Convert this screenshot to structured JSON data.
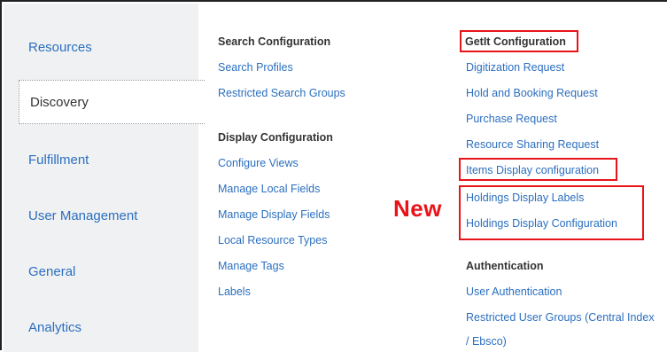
{
  "sidebar": {
    "items": [
      {
        "label": "Resources",
        "active": false
      },
      {
        "label": "Discovery",
        "active": true
      },
      {
        "label": "Fulfillment",
        "active": false
      },
      {
        "label": "User Management",
        "active": false
      },
      {
        "label": "General",
        "active": false
      },
      {
        "label": "Analytics",
        "active": false
      }
    ]
  },
  "search_config": {
    "heading": "Search Configuration",
    "links": [
      "Search Profiles",
      "Restricted Search Groups"
    ]
  },
  "display_config": {
    "heading": "Display Configuration",
    "links": [
      "Configure Views",
      "Manage Local Fields",
      "Manage Display Fields",
      "Local Resource Types",
      "Manage Tags",
      "Labels"
    ]
  },
  "getit_config": {
    "heading": "GetIt Configuration",
    "links": [
      "Digitization Request",
      "Hold and Booking Request",
      "Purchase Request",
      "Resource Sharing Request",
      "Items Display configuration",
      "Holdings Display Labels",
      "Holdings Display Configuration"
    ]
  },
  "authentication": {
    "heading": "Authentication",
    "links": [
      "User Authentication",
      "Restricted User Groups (Central Index",
      "/ Ebsco)"
    ]
  },
  "annotation": {
    "new_label": "New",
    "highlight_color": "#e8141a"
  },
  "colors": {
    "link": "#2b6fbf",
    "sidebar_bg": "#f0f1f3",
    "heading": "#333333"
  }
}
